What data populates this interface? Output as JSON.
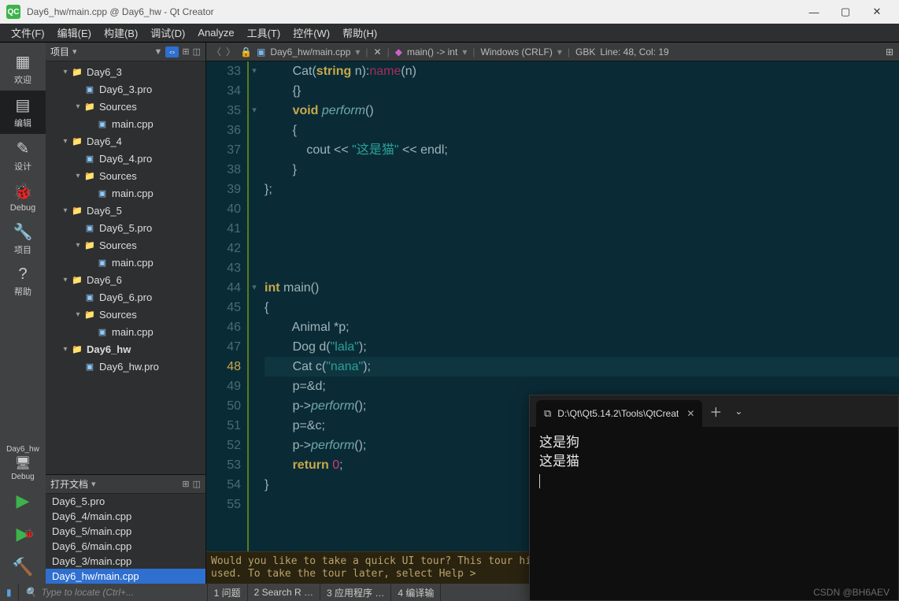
{
  "window": {
    "title": "Day6_hw/main.cpp @ Day6_hw - Qt Creator",
    "logo_text": "QC"
  },
  "menu": [
    "文件(F)",
    "编辑(E)",
    "构建(B)",
    "调试(D)",
    "Analyze",
    "工具(T)",
    "控件(W)",
    "帮助(H)"
  ],
  "modes": {
    "welcome": "欢迎",
    "edit": "编辑",
    "design": "设计",
    "debug": "Debug",
    "projects": "项目",
    "help": "帮助"
  },
  "kit": {
    "target": "Day6_hw",
    "mode": "Debug"
  },
  "projects_header": "项目",
  "tree": [
    {
      "lvl": 1,
      "type": "proj",
      "label": "Day6_3",
      "arrow": "▾"
    },
    {
      "lvl": 2,
      "type": "pro",
      "label": "Day6_3.pro"
    },
    {
      "lvl": 2,
      "type": "folder",
      "label": "Sources",
      "arrow": "▾"
    },
    {
      "lvl": 3,
      "type": "cpp",
      "label": "main.cpp"
    },
    {
      "lvl": 1,
      "type": "proj",
      "label": "Day6_4",
      "arrow": "▾"
    },
    {
      "lvl": 2,
      "type": "pro",
      "label": "Day6_4.pro"
    },
    {
      "lvl": 2,
      "type": "folder",
      "label": "Sources",
      "arrow": "▾"
    },
    {
      "lvl": 3,
      "type": "cpp",
      "label": "main.cpp"
    },
    {
      "lvl": 1,
      "type": "proj",
      "label": "Day6_5",
      "arrow": "▾"
    },
    {
      "lvl": 2,
      "type": "pro",
      "label": "Day6_5.pro"
    },
    {
      "lvl": 2,
      "type": "folder",
      "label": "Sources",
      "arrow": "▾"
    },
    {
      "lvl": 3,
      "type": "cpp",
      "label": "main.cpp"
    },
    {
      "lvl": 1,
      "type": "proj",
      "label": "Day6_6",
      "arrow": "▾"
    },
    {
      "lvl": 2,
      "type": "pro",
      "label": "Day6_6.pro"
    },
    {
      "lvl": 2,
      "type": "folder",
      "label": "Sources",
      "arrow": "▾"
    },
    {
      "lvl": 3,
      "type": "cpp",
      "label": "main.cpp"
    },
    {
      "lvl": 1,
      "type": "proj",
      "label": "Day6_hw",
      "arrow": "▾",
      "bold": true
    },
    {
      "lvl": 2,
      "type": "pro",
      "label": "Day6_hw.pro"
    }
  ],
  "open_docs_header": "打开文档",
  "open_docs": [
    {
      "label": "Day6_5.pro",
      "sel": false
    },
    {
      "label": "Day6_4/main.cpp",
      "sel": false
    },
    {
      "label": "Day6_5/main.cpp",
      "sel": false
    },
    {
      "label": "Day6_6/main.cpp",
      "sel": false
    },
    {
      "label": "Day6_3/main.cpp",
      "sel": false
    },
    {
      "label": "Day6_hw/main.cpp",
      "sel": true
    }
  ],
  "editor": {
    "file_label": "Day6_hw/main.cpp",
    "symbol": "main() -> int",
    "line_ending": "Windows (CRLF)",
    "encoding": "GBK",
    "cursor": "Line: 48, Col: 19",
    "first_line": 33,
    "current_line": 48,
    "lines": [
      {
        "n": 33,
        "fold": "▾",
        "html": "        Cat(<span class='kw'>string</span> n):<span class='name-pink'>name</span>(n)"
      },
      {
        "n": 34,
        "html": "        {}"
      },
      {
        "n": 35,
        "fold": "▾",
        "html": "        <span class='kw'>void</span> <span class='fn-it'>perform</span>()"
      },
      {
        "n": 36,
        "html": "        {"
      },
      {
        "n": 37,
        "html": "            cout &lt;&lt; <span class='str'>\"这是猫\"</span> &lt;&lt; endl;"
      },
      {
        "n": 38,
        "html": "        }"
      },
      {
        "n": 39,
        "html": "};"
      },
      {
        "n": 40,
        "html": ""
      },
      {
        "n": 41,
        "html": ""
      },
      {
        "n": 42,
        "html": ""
      },
      {
        "n": 43,
        "html": ""
      },
      {
        "n": 44,
        "fold": "▾",
        "html": "<span class='kw'>int</span> main()"
      },
      {
        "n": 45,
        "html": "{"
      },
      {
        "n": 46,
        "html": "        Animal *p;"
      },
      {
        "n": 47,
        "html": "        Dog d(<span class='str'>\"lala\"</span>);"
      },
      {
        "n": 48,
        "html": "        Cat c(<span class='str'>\"nana\"</span>);"
      },
      {
        "n": 49,
        "html": "        p=&amp;d;"
      },
      {
        "n": 50,
        "html": "        p-&gt;<span class='fn-it'>perform</span>();"
      },
      {
        "n": 51,
        "html": "        p=&amp;c;"
      },
      {
        "n": 52,
        "html": "        p-&gt;<span class='fn-it'>perform</span>();"
      },
      {
        "n": 53,
        "html": "        <span class='kw'>return</span> <span class='num'>0</span>;"
      },
      {
        "n": 54,
        "html": "}"
      },
      {
        "n": 55,
        "html": ""
      }
    ],
    "tour_msg": "Would you like to take a quick UI tour? This tour highlights important user\nelements and shows how they are used. To take the tour later, select Help >"
  },
  "status": {
    "locate_placeholder": "Type to locate (Ctrl+...",
    "panes": [
      "1  问题",
      "2  Search R …",
      "3  应用程序 …",
      "4  编译输"
    ]
  },
  "terminal": {
    "tab_title": "D:\\Qt\\Qt5.14.2\\Tools\\QtCreat",
    "lines": [
      "这是狗",
      "这是猫"
    ]
  },
  "watermark": "CSDN @BH6AEV"
}
